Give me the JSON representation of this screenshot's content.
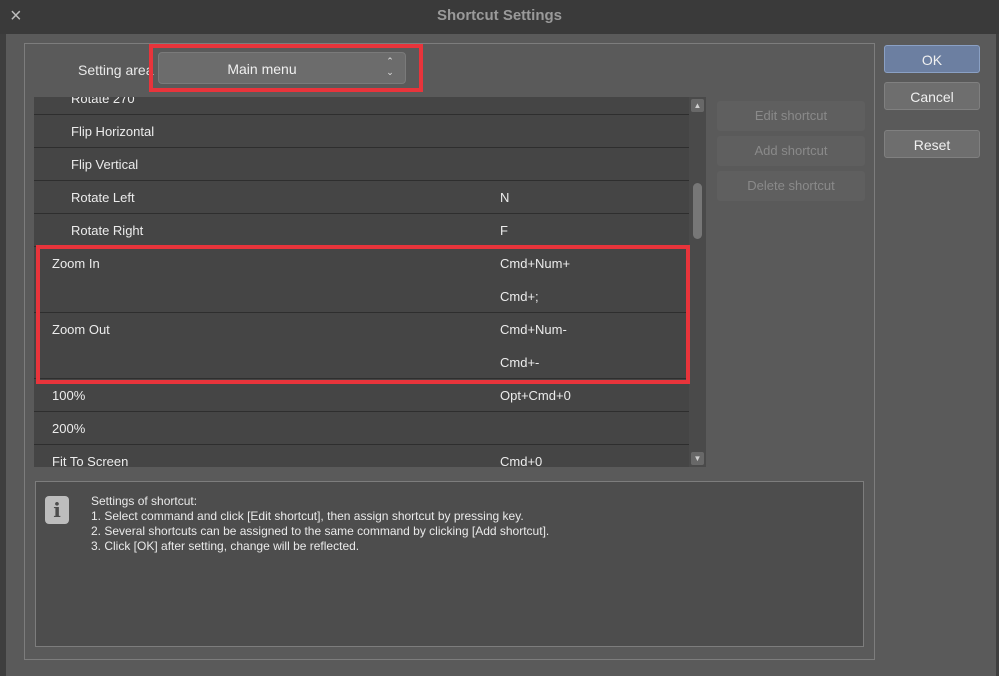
{
  "window": {
    "title": "Shortcut Settings",
    "close_glyph": "×"
  },
  "setting_area": {
    "label": "Setting area",
    "value": "Main menu",
    "arrows_up": "⌃",
    "arrows_down": "⌄"
  },
  "rows": [
    {
      "cmd": "Rotate 270",
      "key": ""
    },
    {
      "cmd": "Flip Horizontal",
      "key": ""
    },
    {
      "cmd": "Flip Vertical",
      "key": ""
    },
    {
      "cmd": "Rotate Left",
      "key": "N"
    },
    {
      "cmd": "Rotate Right",
      "key": "F"
    },
    {
      "cmd": "Zoom In",
      "key": "Cmd+Num+",
      "key2": "Cmd+;"
    },
    {
      "cmd": "Zoom Out",
      "key": "Cmd+Num-",
      "key2": "Cmd+-"
    },
    {
      "cmd": "100%",
      "key": "Opt+Cmd+0"
    },
    {
      "cmd": "200%",
      "key": ""
    },
    {
      "cmd": "Fit To Screen",
      "key": "Cmd+0"
    }
  ],
  "side_buttons": {
    "edit": "Edit shortcut",
    "add": "Add shortcut",
    "delete": "Delete shortcut"
  },
  "buttons": {
    "ok": "OK",
    "cancel": "Cancel",
    "reset": "Reset"
  },
  "info": {
    "icon": "i",
    "heading": "Settings of shortcut:",
    "line1": "1. Select command and click [Edit shortcut], then assign shortcut by pressing key.",
    "line2": "2. Several shortcuts can be assigned to the same command by clicking [Add shortcut].",
    "line3": "3. Click [OK] after setting, change will be reflected."
  },
  "colors": {
    "highlight": "#e8343b",
    "ok_button": "#6c7fa1"
  }
}
